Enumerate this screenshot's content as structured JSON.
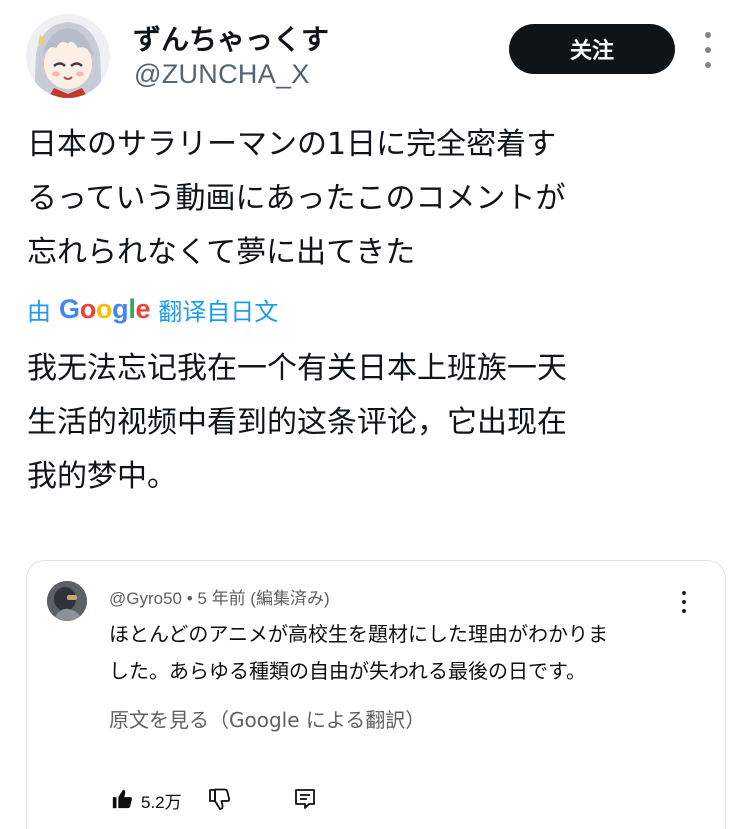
{
  "user": {
    "display_name": "ずんちゃっくす",
    "handle": "@ZUNCHA_X",
    "follow_label": "关注"
  },
  "tweet": {
    "lines": [
      "日本のサラリーマンの1日に完全密着す",
      "るっていう動画にあったこのコメントが",
      "忘れられなくて夢に出てきた"
    ]
  },
  "translation": {
    "prefix": "由",
    "provider": "Google",
    "suffix": "翻译自日文",
    "lines": [
      "我无法忘记我在一个有关日本上班族一天",
      "生活的视频中看到的这条评论，它出现在",
      "我的梦中。"
    ]
  },
  "comment": {
    "meta": "@Gyro50 • 5 年前 (編集済み)",
    "lines": [
      "ほとんどのアニメが高校生を題材にした理由がわかりま",
      "した。あらゆる種類の自由が失われる最後の日です。"
    ],
    "see_original": "原文を見る（Google による翻訳）",
    "like_count": "5.2万"
  },
  "icons": {
    "more": "more-vertical-icon",
    "like": "thumbs-up-icon",
    "dislike": "thumbs-down-icon",
    "reply": "comment-reply-icon"
  },
  "colors": {
    "link_blue": "#1d9bf0",
    "follow_bg": "#0f1419",
    "secondary_text": "#536471"
  }
}
